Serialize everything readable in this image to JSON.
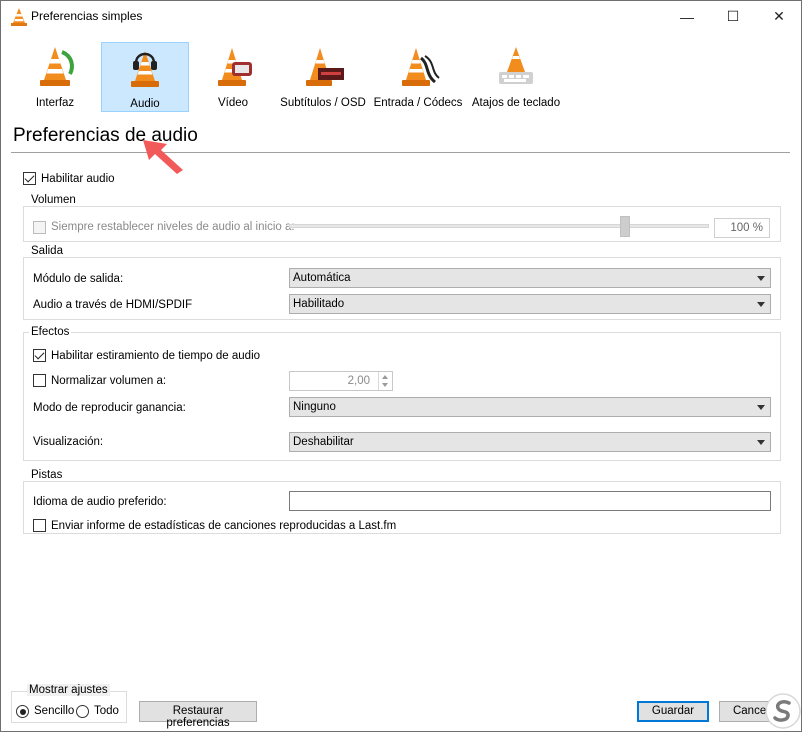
{
  "window": {
    "title": "Preferencias simples",
    "controls": {
      "minimize": "—",
      "maximize": "☐",
      "close": "✕"
    }
  },
  "categories": [
    {
      "key": "interfaz",
      "label": "Interfaz",
      "selected": false
    },
    {
      "key": "audio",
      "label": "Audio",
      "selected": true
    },
    {
      "key": "video",
      "label": "Vídeo",
      "selected": false
    },
    {
      "key": "subtitulos",
      "label": "Subtítulos / OSD",
      "selected": false
    },
    {
      "key": "entrada",
      "label": "Entrada / Códecs",
      "selected": false
    },
    {
      "key": "atajos",
      "label": "Atajos de teclado",
      "selected": false
    }
  ],
  "page": {
    "title": "Preferencias de audio"
  },
  "enable_audio": {
    "label": "Habilitar audio",
    "checked": true
  },
  "volume": {
    "group_title": "Volumen",
    "reset_label": "Siempre restablecer niveles de audio al inicio a:",
    "reset_checked": false,
    "value": "100 %",
    "slider_fraction": 1.0
  },
  "output": {
    "group_title": "Salida",
    "module_label": "Módulo de salida:",
    "module_value": "Automática",
    "hdmi_label": "Audio a través de HDMI/SPDIF",
    "hdmi_value": "Habilitado"
  },
  "effects": {
    "group_title": "Efectos",
    "stretch_label": "Habilitar estiramiento de tiempo de audio",
    "stretch_checked": true,
    "normalize_label": "Normalizar volumen a:",
    "normalize_checked": false,
    "normalize_value": "2,00",
    "replay_gain_label": "Modo de reproducir ganancia:",
    "replay_gain_value": "Ninguno",
    "visualization_label": "Visualización:",
    "visualization_value": "Deshabilitar"
  },
  "tracks": {
    "group_title": "Pistas",
    "language_label": "Idioma de audio preferido:",
    "language_value": "",
    "lastfm_label": "Enviar informe de estadísticas de canciones reproducidas a Last.fm",
    "lastfm_checked": false
  },
  "footer": {
    "show_settings_label": "Mostrar ajustes",
    "simple_label": "Sencillo",
    "all_label": "Todo",
    "simple_selected": true,
    "reset_button": "Restaurar preferencias",
    "save_button": "Guardar",
    "cancel_button": "Cancelar"
  },
  "colors": {
    "selected_tab_bg": "#cce8ff",
    "selected_tab_border": "#99d1ff",
    "primary_button_border": "#0078d7",
    "annotation_arrow": "#f25a5a"
  }
}
